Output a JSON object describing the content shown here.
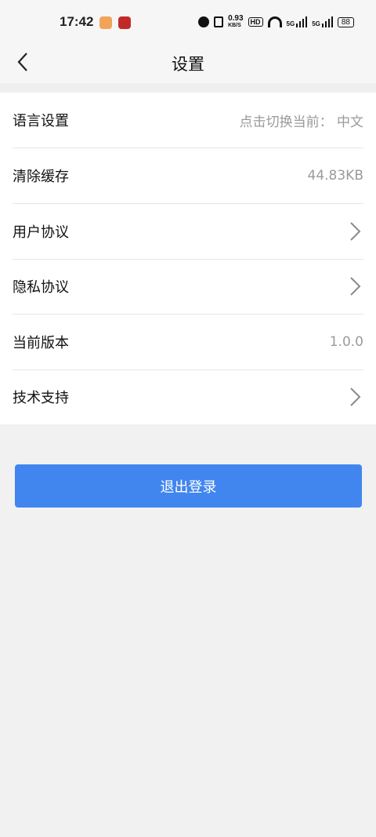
{
  "status_bar": {
    "time": "17:42",
    "net_speed_value": "0.93",
    "net_speed_unit": "KB/S",
    "hd_label": "HD",
    "sig1_label": "5G",
    "sig2_label": "5G",
    "battery": "88"
  },
  "header": {
    "title": "设置"
  },
  "settings": [
    {
      "label": "语言设置",
      "value": "点击切换当前：  中文",
      "chevron": false
    },
    {
      "label": "清除缓存",
      "value": "44.83KB",
      "chevron": false
    },
    {
      "label": "用户协议",
      "value": "",
      "chevron": true
    },
    {
      "label": "隐私协议",
      "value": "",
      "chevron": true
    },
    {
      "label": "当前版本",
      "value": "1.0.0",
      "chevron": false
    },
    {
      "label": "技术支持",
      "value": "",
      "chevron": true
    }
  ],
  "logout_label": "退出登录",
  "colors": {
    "primary_button": "#4186ef",
    "secondary_text": "#9a9a9a"
  }
}
